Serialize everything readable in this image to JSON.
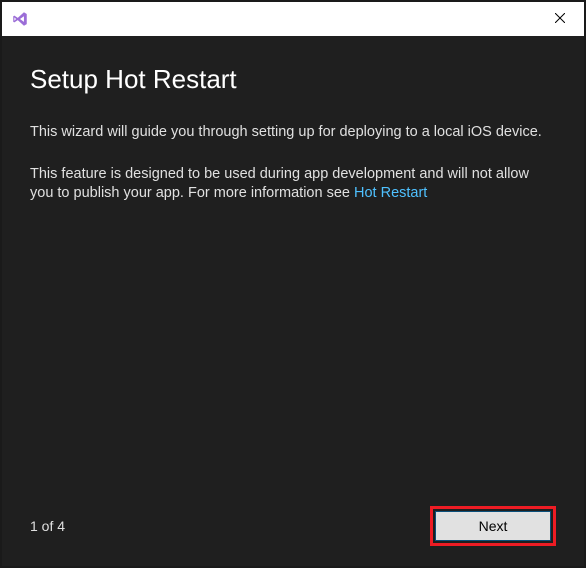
{
  "window": {
    "close": "✕"
  },
  "heading": "Setup Hot Restart",
  "para1": "This wizard will guide you through setting up for deploying to a local iOS device.",
  "para2_pre": "This feature is designed to be used during app development and will not allow you to publish your app. For more information see ",
  "para2_link": "Hot Restart",
  "footer": {
    "step": "1 of 4",
    "next": "Next"
  }
}
